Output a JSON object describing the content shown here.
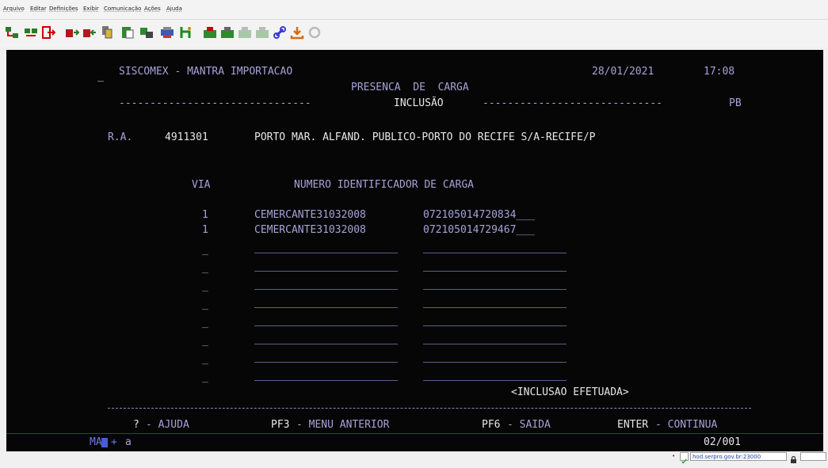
{
  "menu": [
    "Arquivo",
    "Editar",
    "Definições",
    "Exibir",
    "Comunicação",
    "Ações",
    "Ajuda"
  ],
  "toolbar_icons": [
    "connect-icon",
    "disconnect-icon",
    "exit-icon",
    "send-file-icon",
    "receive-file-icon",
    "copy-icon",
    "paste-icon",
    "transfer-icon",
    "print-icon",
    "macro-icon",
    "record-icon",
    "play-icon",
    "stop-icon",
    "pause-icon",
    "link-icon",
    "download-icon",
    "refresh-icon"
  ],
  "screen": {
    "cursor_mark": "_",
    "system_name": "SISCOMEX - MANTRA IMPORTACAO",
    "date": "28/01/2021",
    "time": "17:08",
    "screen_title": "PRESENCA  DE  CARGA",
    "mode_dashes_left": "-------------------------------",
    "mode_label": "INCLUSÃO",
    "mode_dashes_right": "-----------------------------",
    "state": "PB",
    "ra_label": "R.A.",
    "ra_code": "4911301",
    "ra_description": "PORTO MAR. ALFAND. PUBLICO-PORTO DO RECIFE S/A-RECIFE/P",
    "col_via": "VIA",
    "col_numero": "NUMERO IDENTIFICADOR DE CARGA",
    "rows": [
      {
        "via": "1",
        "ce": "CEMERCANTE31032008",
        "numero": "072105014720834___"
      },
      {
        "via": "1",
        "ce": "CEMERCANTE31032008",
        "numero": "072105014729467___"
      },
      {
        "via": "_",
        "ce": "",
        "numero": ""
      },
      {
        "via": "_",
        "ce": "",
        "numero": ""
      },
      {
        "via": "_",
        "ce": "",
        "numero": ""
      },
      {
        "via": "_",
        "ce": "",
        "numero": ""
      },
      {
        "via": "_",
        "ce": "",
        "numero": ""
      },
      {
        "via": "_",
        "ce": "",
        "numero": ""
      },
      {
        "via": "_",
        "ce": "",
        "numero": ""
      },
      {
        "via": "_",
        "ce": "",
        "numero": ""
      }
    ],
    "message": "<INCLUSAO EFETUADA>",
    "keys": {
      "help_key": "?",
      "help_label": "- AJUDA",
      "back_key": "PF3",
      "back_label": "- MENU ANTERIOR",
      "exit_key": "PF6",
      "exit_label": "- SAIDA",
      "continue_key": "ENTER",
      "continue_label": "- CONTINUA"
    },
    "oia_session": "MA",
    "oia_arrow": "+",
    "oia_char": "a",
    "page_indicator": "02/001"
  },
  "status": {
    "connection": "hod.serpro.gov.br:23000"
  }
}
